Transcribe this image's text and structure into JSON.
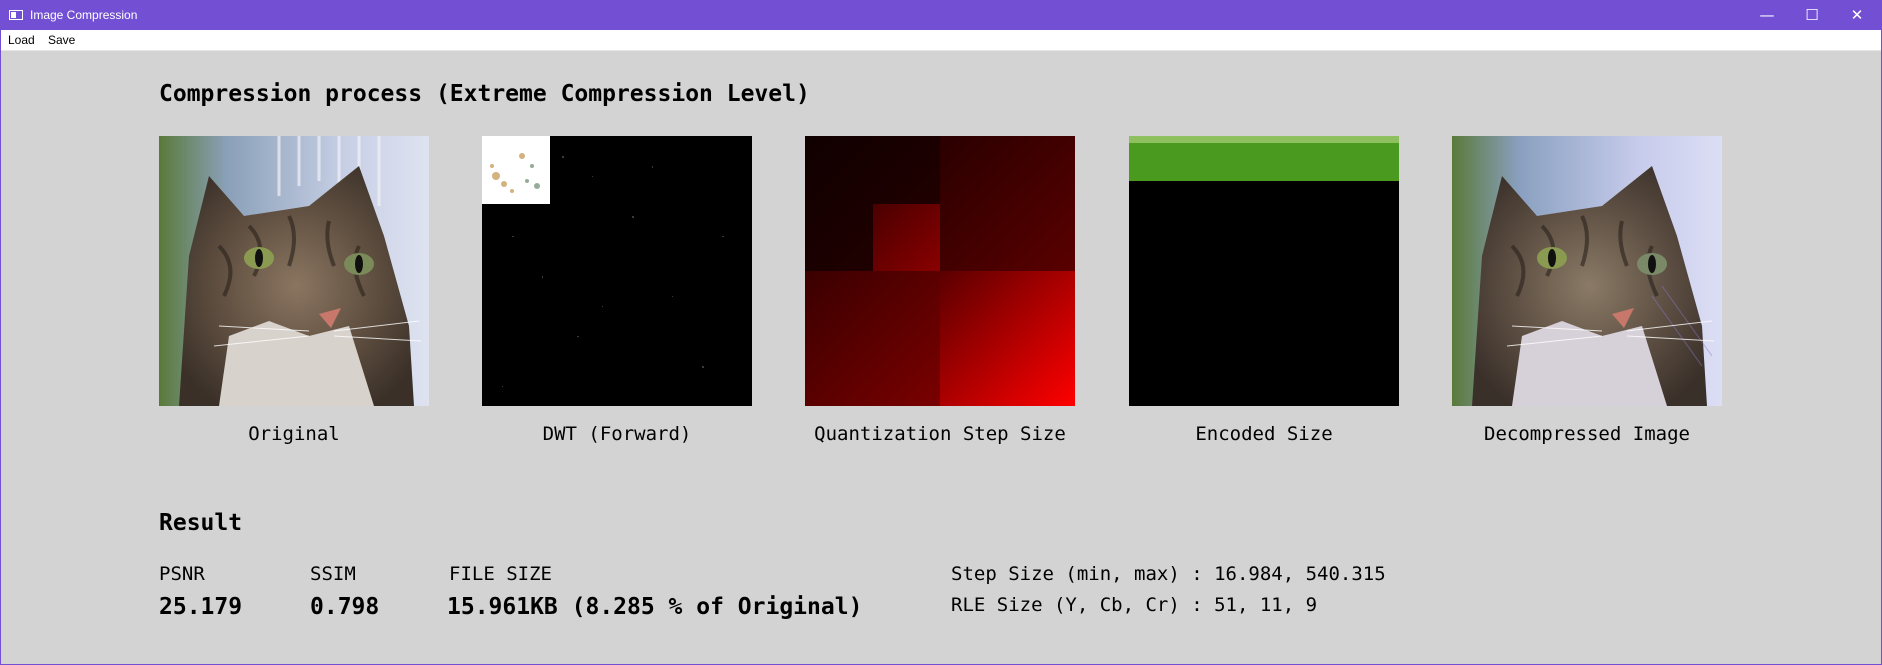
{
  "window": {
    "title": "Image Compression"
  },
  "menu": {
    "items": [
      "Load",
      "Save"
    ]
  },
  "section": {
    "title": "Compression process (Extreme Compression Level)"
  },
  "panels": [
    {
      "caption": "Original"
    },
    {
      "caption": "DWT (Forward)"
    },
    {
      "caption": "Quantization Step Size"
    },
    {
      "caption": "Encoded Size"
    },
    {
      "caption": "Decompressed Image"
    }
  ],
  "result": {
    "title": "Result",
    "psnr": {
      "label": "PSNR",
      "value": "25.179"
    },
    "ssim": {
      "label": "SSIM",
      "value": "0.798"
    },
    "file_size": {
      "label": "FILE SIZE",
      "value": "15.961KB (8.285 % of Original)"
    },
    "step_size": "Step Size (min, max) : 16.984, 540.315",
    "rle_size": "RLE Size (Y, Cb, Cr) : 51, 11, 9"
  },
  "colors": {
    "titlebar": "#7350d3",
    "background": "#d3d3d3",
    "encoded_bar": "#4a9a20",
    "quantization": "#ff0000"
  }
}
